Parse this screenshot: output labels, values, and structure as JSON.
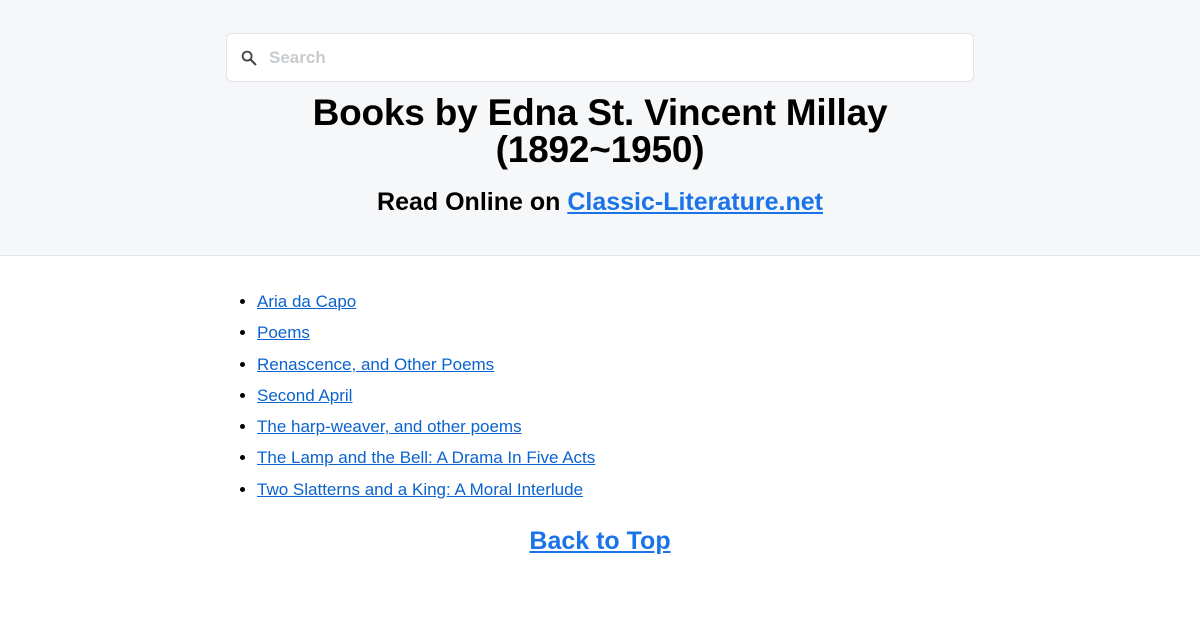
{
  "search": {
    "placeholder": "Search",
    "icon": "search-icon"
  },
  "header": {
    "title_line1": "Books by Edna St. Vincent Millay",
    "title_line2": "(1892~1950)",
    "subtitle_prefix": "Read Online on ",
    "site_link": "Classic-Literature.net"
  },
  "books": [
    {
      "title": "Aria da Capo"
    },
    {
      "title": "Poems"
    },
    {
      "title": "Renascence, and Other Poems"
    },
    {
      "title": "Second April"
    },
    {
      "title": "The harp-weaver, and other poems"
    },
    {
      "title": "The Lamp and the Bell: A Drama In Five Acts"
    },
    {
      "title": "Two Slatterns and a King: A Moral Interlude"
    }
  ],
  "footer": {
    "back_to_top": "Back to Top"
  },
  "colors": {
    "link": "#0b63ce",
    "accent_link": "#1a73e8",
    "header_bg": "#f6f7f9"
  }
}
